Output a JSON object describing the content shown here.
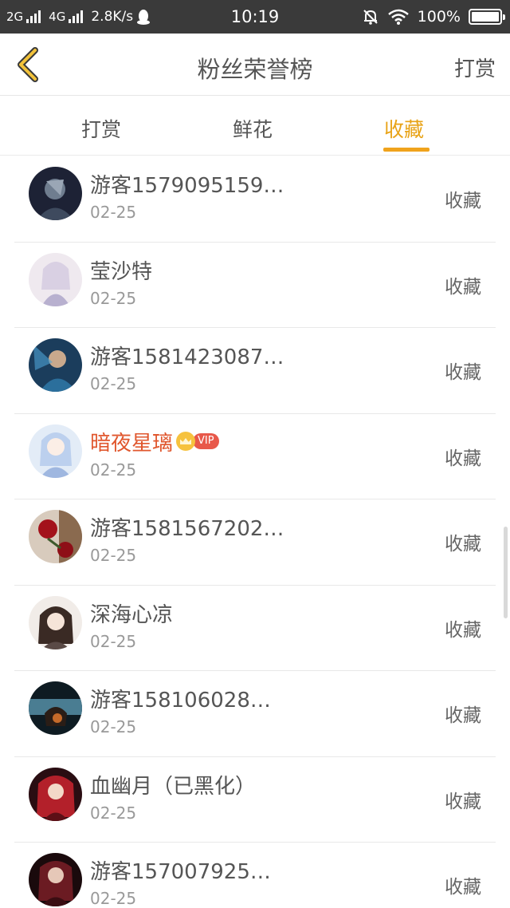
{
  "status_bar": {
    "net1": "2G",
    "net2": "4G",
    "speed": "2.8K/s",
    "time": "10:19",
    "battery": "100%"
  },
  "header": {
    "title": "粉丝荣誉榜",
    "action": "打赏"
  },
  "tabs": [
    {
      "label": "打赏"
    },
    {
      "label": "鲜花"
    },
    {
      "label": "收藏",
      "active": true
    }
  ],
  "colors": {
    "accent": "#f0a31c",
    "vip_name": "#e0572e"
  },
  "fans": [
    {
      "name": "游客1579095159…",
      "date": "02-25",
      "action": "收藏"
    },
    {
      "name": "莹沙特",
      "date": "02-25",
      "action": "收藏"
    },
    {
      "name": "游客1581423087…",
      "date": "02-25",
      "action": "收藏"
    },
    {
      "name": "暗夜星璃",
      "date": "02-25",
      "action": "收藏",
      "vip_label": "VIP"
    },
    {
      "name": "游客1581567202…",
      "date": "02-25",
      "action": "收藏"
    },
    {
      "name": "深海心凉",
      "date": "02-25",
      "action": "收藏"
    },
    {
      "name": "游客158106028…",
      "date": "02-25",
      "action": "收藏"
    },
    {
      "name": "血幽月（已黑化）",
      "date": "02-25",
      "action": "收藏"
    },
    {
      "name": "游客157007925…",
      "date": "02-25",
      "action": "收藏"
    }
  ]
}
